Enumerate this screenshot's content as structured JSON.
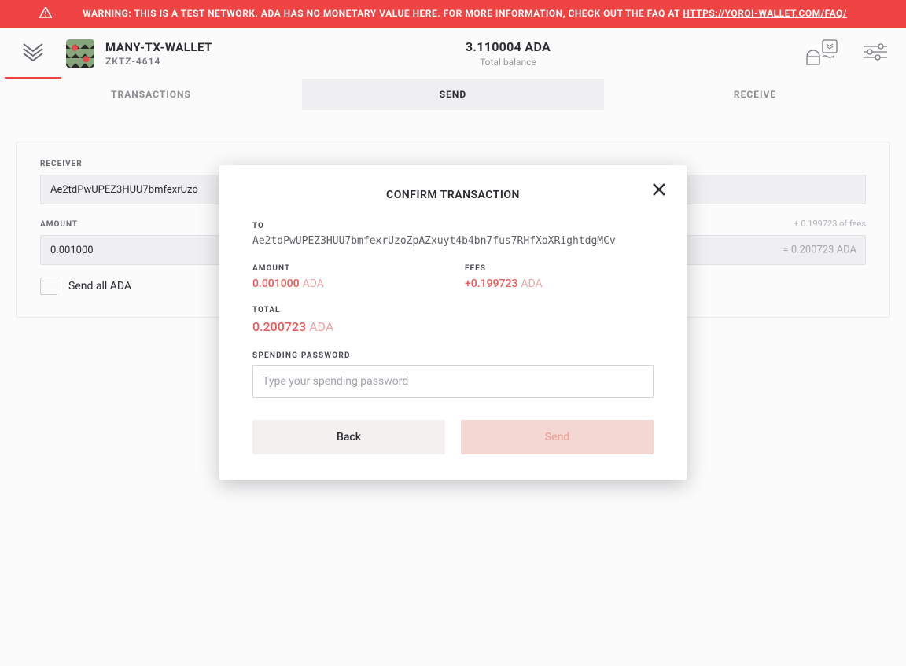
{
  "warning": {
    "prefix": "WARNING: THIS IS A TEST NETWORK. ADA HAS NO MONETARY VALUE HERE. FOR MORE INFORMATION, CHECK OUT THE FAQ AT ",
    "link": "HTTPS://YOROI-WALLET.COM/FAQ/"
  },
  "header": {
    "wallet_name": "MANY-TX-WALLET",
    "wallet_sub": "ZKTZ-4614",
    "balance_amount": "3.110004 ADA",
    "balance_label": "Total balance"
  },
  "tabs": {
    "transactions": "TRANSACTIONS",
    "send": "SEND",
    "receive": "RECEIVE"
  },
  "send_form": {
    "receiver_label": "RECEIVER",
    "receiver_value": "Ae2tdPwUPEZ3HUU7bmfexrUzo",
    "amount_label": "AMOUNT",
    "amount_value": "0.001000",
    "fees_hint": "+ 0.199723 of fees",
    "amount_suffix": "= 0.200723 ADA",
    "send_all_label": "Send all ADA"
  },
  "modal": {
    "title": "CONFIRM TRANSACTION",
    "to_label": "TO",
    "to_value": "Ae2tdPwUPEZ3HUU7bmfexrUzoZpAZxuyt4b4bn7fus7RHfXoXRightdgMCv",
    "amount_label": "AMOUNT",
    "amount_num": "0.001000",
    "amount_unit": "ADA",
    "fees_label": "FEES",
    "fees_num": "+0.199723",
    "fees_unit": "ADA",
    "total_label": "TOTAL",
    "total_num": "0.200723",
    "total_unit": "ADA",
    "pw_label": "SPENDING PASSWORD",
    "pw_placeholder": "Type your spending password",
    "back_label": "Back",
    "send_label": "Send"
  }
}
